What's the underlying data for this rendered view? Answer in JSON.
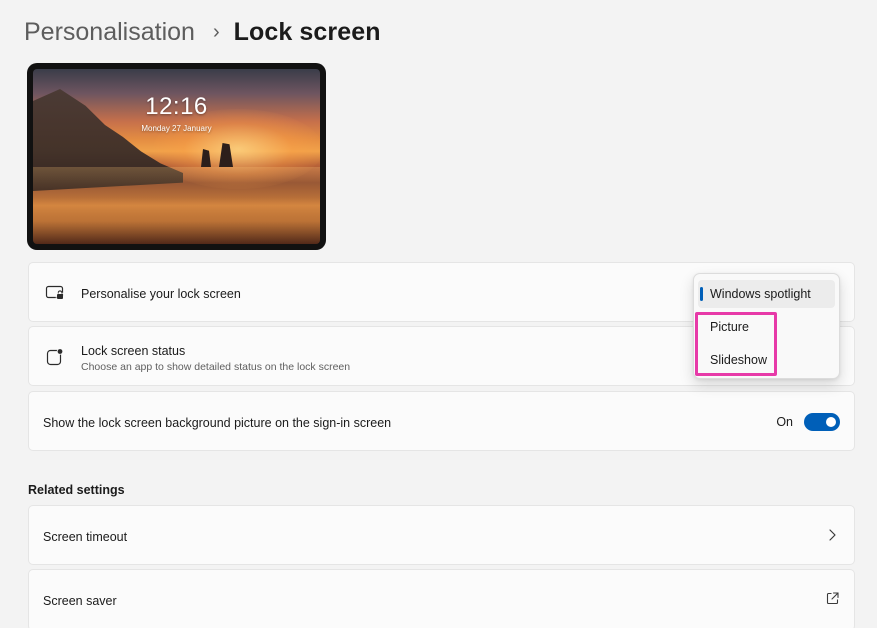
{
  "breadcrumb": {
    "parent": "Personalisation",
    "separator": "›",
    "current": "Lock screen"
  },
  "preview": {
    "time": "12:16",
    "date": "Monday 27 January"
  },
  "settings": {
    "personalise": {
      "title": "Personalise your lock screen",
      "icon": "lock-screen-icon"
    },
    "status": {
      "title": "Lock screen status",
      "subtitle": "Choose an app to show detailed status on the lock screen",
      "icon": "status-app-icon"
    },
    "background": {
      "title": "Show the lock screen background picture on the sign-in screen",
      "toggle_label": "On",
      "toggle_on": true
    }
  },
  "dropdown": {
    "options": [
      "Windows spotlight",
      "Picture",
      "Slideshow"
    ],
    "selected": "Windows spotlight",
    "highlighted": [
      "Picture",
      "Slideshow"
    ]
  },
  "related": {
    "label": "Related settings",
    "timeout": {
      "title": "Screen timeout",
      "icon": "chevron-right-icon"
    },
    "saver": {
      "title": "Screen saver",
      "icon": "external-link-icon"
    }
  },
  "colors": {
    "accent": "#005fb8",
    "highlight": "#e73aa8",
    "background": "#f3f3f3",
    "card": "#fbfbfb"
  }
}
